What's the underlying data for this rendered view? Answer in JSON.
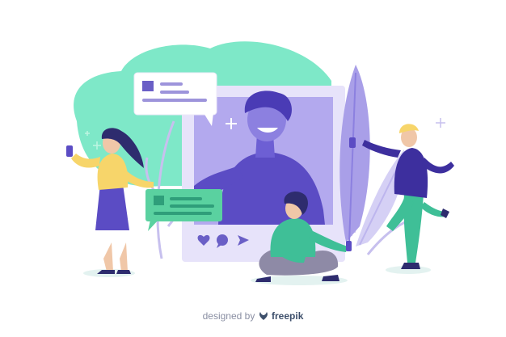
{
  "credit": {
    "prefix": "designed by",
    "brand": "freepik"
  },
  "icons": [
    "heart-icon",
    "comment-icon",
    "send-icon",
    "sparkle-icon",
    "freepik-logo-icon"
  ],
  "colors": {
    "mint": "#7EE8C8",
    "lavender": "#C9C2F2",
    "purple": "#5B4CC4",
    "dark_purple": "#3D2F9E",
    "teal": "#3FBF97",
    "green_card": "#5AD1A0",
    "yellow": "#F7D56A",
    "navy": "#2E2C6E",
    "gray": "#8E8AA6"
  }
}
